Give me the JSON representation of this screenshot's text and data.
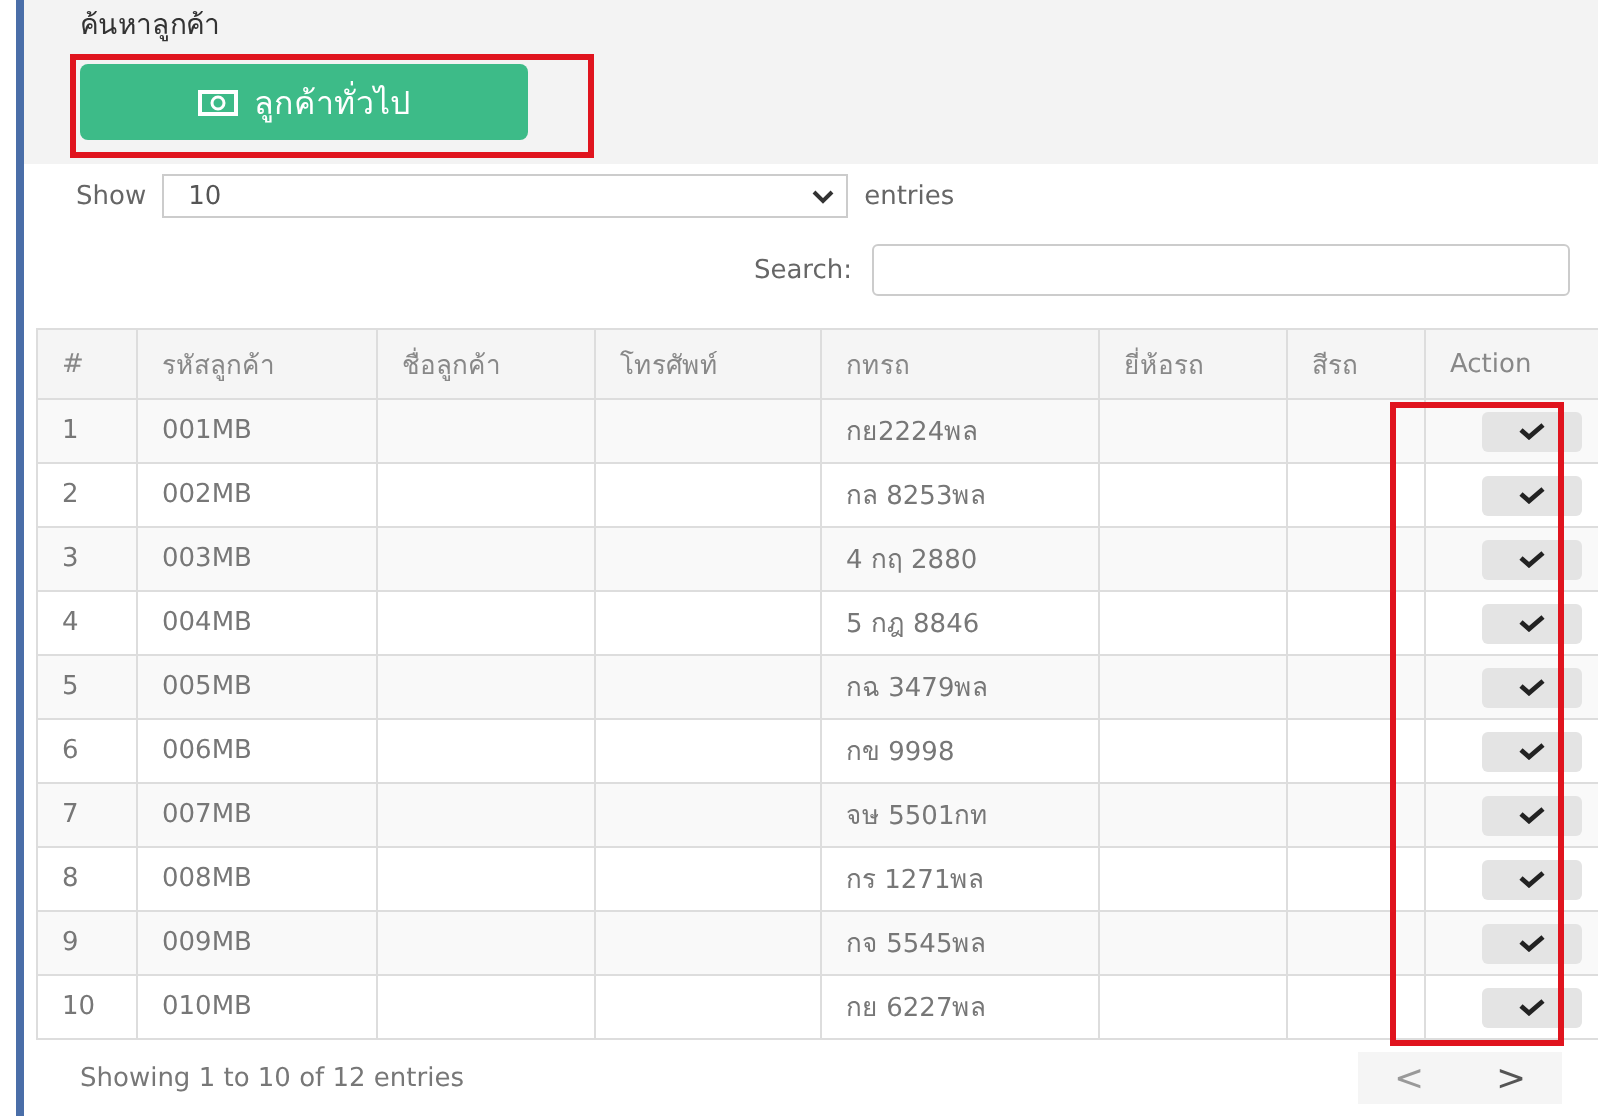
{
  "page": {
    "title": "ค้นหาลูกค้า"
  },
  "general_customer_button": {
    "label": "ลูกค้าทั่วไป",
    "highlighted": true
  },
  "length_menu": {
    "prefix": "Show",
    "value": "10",
    "suffix": "entries"
  },
  "search": {
    "label": "Search:"
  },
  "table": {
    "columns": [
      "#",
      "รหัสลูกค้า",
      "ชื่อลูกค้า",
      "โทรศัพท์",
      "กทรถ",
      "ยี่ห้อรถ",
      "สีรถ",
      "Action"
    ],
    "action_column_highlighted": true,
    "rows": [
      {
        "number": "1",
        "code": "001MB",
        "plate": "กย2224พล"
      },
      {
        "number": "2",
        "code": "002MB",
        "plate": "กล 8253พล"
      },
      {
        "number": "3",
        "code": "003MB",
        "plate": "4 กฤ 2880"
      },
      {
        "number": "4",
        "code": "004MB",
        "plate": "5 กฎ 8846"
      },
      {
        "number": "5",
        "code": "005MB",
        "plate": "กฉ 3479พล"
      },
      {
        "number": "6",
        "code": "006MB",
        "plate": "กข 9998"
      },
      {
        "number": "7",
        "code": "007MB",
        "plate": "จษ 5501กท"
      },
      {
        "number": "8",
        "code": "008MB",
        "plate": "กร 1271พล"
      },
      {
        "number": "9",
        "code": "009MB",
        "plate": "กจ 5545พล"
      },
      {
        "number": "10",
        "code": "010MB",
        "plate": "กย 6227พล"
      }
    ]
  },
  "footer": {
    "info": "Showing 1 to 10 of 12 entries",
    "pagination": [
      {
        "label": "<",
        "disabled": true
      },
      {
        "label": ">",
        "disabled": false
      }
    ]
  }
}
